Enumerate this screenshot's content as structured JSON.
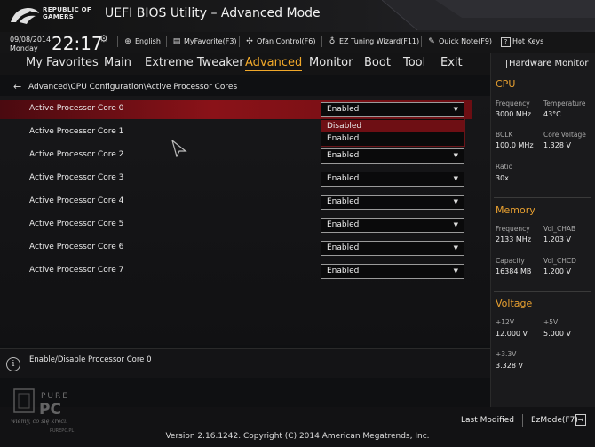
{
  "header": {
    "brand_line1": "REPUBLIC OF",
    "brand_line2": "GAMERS",
    "title": "UEFI BIOS Utility – Advanced Mode"
  },
  "status": {
    "date": "09/08/2014",
    "day": "Monday",
    "time": "22:17",
    "time_icon": "gear-icon",
    "tools": [
      {
        "label": "English",
        "icon": "globe-icon"
      },
      {
        "label": "MyFavorite(F3)",
        "icon": "favorite-icon"
      },
      {
        "label": "Qfan Control(F6)",
        "icon": "fan-icon"
      },
      {
        "label": "EZ Tuning Wizard(F11)",
        "icon": "wizard-icon"
      },
      {
        "label": "Quick Note(F9)",
        "icon": "note-icon"
      },
      {
        "label": "Hot Keys",
        "icon": "help-icon"
      }
    ]
  },
  "menu": {
    "items": [
      "My Favorites",
      "Main",
      "Extreme Tweaker",
      "Advanced",
      "Monitor",
      "Boot",
      "Tool",
      "Exit"
    ],
    "active": "Advanced"
  },
  "breadcrumb": "Advanced\\CPU Configuration\\Active Processor Cores",
  "settings": [
    {
      "label": "Active Processor Core 0",
      "value": "Enabled"
    },
    {
      "label": "Active Processor Core 1",
      "value": "Enabled"
    },
    {
      "label": "Active Processor Core 2",
      "value": "Enabled"
    },
    {
      "label": "Active Processor Core 3",
      "value": "Enabled"
    },
    {
      "label": "Active Processor Core 4",
      "value": "Enabled"
    },
    {
      "label": "Active Processor Core 5",
      "value": "Enabled"
    },
    {
      "label": "Active Processor Core 6",
      "value": "Enabled"
    },
    {
      "label": "Active Processor Core 7",
      "value": "Enabled"
    }
  ],
  "dropdown": {
    "options": [
      "Disabled",
      "Enabled"
    ],
    "highlighted": "Disabled"
  },
  "help_text": "Enable/Disable Processor Core 0",
  "watermark": {
    "brand": "PURE PC",
    "tagline": "wiemy, co się kręci!",
    "site": "PUREPC.PL"
  },
  "footer": {
    "last_modified": "Last Modified",
    "ezmode": "EzMode(F7)",
    "version": "Version 2.16.1242. Copyright (C) 2014 American Megatrends, Inc."
  },
  "hw_monitor": {
    "title": "Hardware Monitor",
    "cpu": {
      "heading": "CPU",
      "frequency_label": "Frequency",
      "frequency": "3000 MHz",
      "temperature_label": "Temperature",
      "temperature": "43°C",
      "bclk_label": "BCLK",
      "bclk": "100.0 MHz",
      "core_voltage_label": "Core Voltage",
      "core_voltage": "1.328 V",
      "ratio_label": "Ratio",
      "ratio": "30x"
    },
    "memory": {
      "heading": "Memory",
      "frequency_label": "Frequency",
      "frequency": "2133 MHz",
      "vol_chab_label": "Vol_CHAB",
      "vol_chab": "1.203 V",
      "capacity_label": "Capacity",
      "capacity": "16384 MB",
      "vol_chcd_label": "Vol_CHCD",
      "vol_chcd": "1.200 V"
    },
    "voltage": {
      "heading": "Voltage",
      "v12_label": "+12V",
      "v12": "12.000 V",
      "v5_label": "+5V",
      "v5": "5.000 V",
      "v33_label": "+3.3V",
      "v33": "3.328 V"
    }
  },
  "colors": {
    "accent": "#f0a82a",
    "selection_red": "#8a1218",
    "background": "#0f1012"
  }
}
